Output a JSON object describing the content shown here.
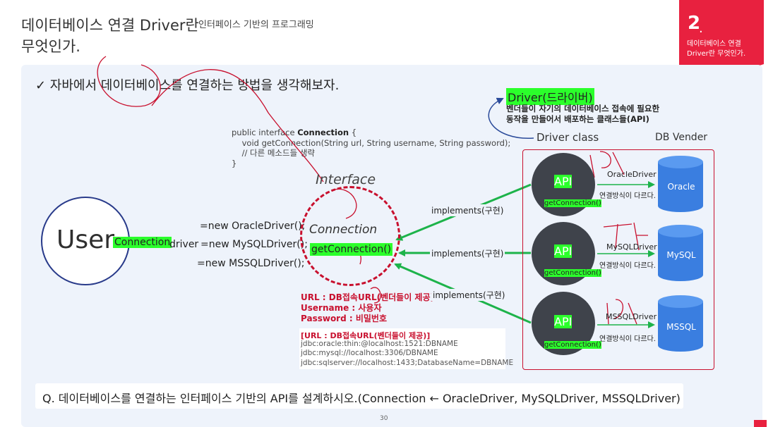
{
  "header": {
    "title_line1": "데이터베이스 연결 Driver란",
    "subtitle": "인터페이스 기반의 프로그래밍",
    "title_line2": "무엇인가."
  },
  "badge": {
    "number": "2",
    "dot": ".",
    "line1": "데이터베이스 연결",
    "line2": "Driver란 무엇인가."
  },
  "heading": "✓ 자바에서 데이터베이스를 연결하는 방법을 생각해보자.",
  "code": {
    "line1_prefix": "public interface ",
    "line1_name": "Connection",
    "line1_suffix": " {",
    "line2": "    void getConnection(String url, String username, String password);",
    "line3": "    // 다른 메소드들 생략",
    "line4": "}"
  },
  "user": {
    "label": "User",
    "connection_tag": "Connection",
    "driver_text": " driver",
    "new_oracle": "=new OracleDriver();",
    "new_mysql": "=new MySQLDriver();",
    "new_mssql": "=new MSSQLDriver();"
  },
  "interface": {
    "label": "Interface",
    "name": "Connection",
    "method": "getConnection()"
  },
  "params": {
    "url": "URL : DB접속URL(벤더들이 제공)",
    "username": "Username : 사용자",
    "password": "Password : 비밀번호"
  },
  "jdbc": {
    "title": "[URL : DB접속URL(벤더들이 제공)]",
    "oracle": "jdbc:oracle:thin:@localhost:1521:DBNAME",
    "mysql": "jdbc:mysql://localhost:3306/DBNAME",
    "mssql": "jdbc:sqlserver://localhost:1433;DatabaseName=DBNAME"
  },
  "implements_label": "implements(구현)",
  "driver_info": {
    "title": "Driver(드라이버)",
    "desc1": "벤더들이 자기의 데이터베이스 접속에 필요한",
    "desc2": "동작을 만들어서 배포하는 클래스들(API)",
    "driver_class": "Driver class",
    "db_vender": "DB Vender"
  },
  "vendors": [
    {
      "api": "API",
      "method": "getConnection()",
      "driver": "OracleDriver",
      "note": "연결방식이 다르다.",
      "db": "Oracle"
    },
    {
      "api": "API",
      "method": "getConnection()",
      "driver": "MySQLDriver",
      "note": "연결방식이 다르다.",
      "db": "MySQL"
    },
    {
      "api": "API",
      "method": "getConnection()",
      "driver": "MSSQLDriver",
      "note": "연결방식이 다르다.",
      "db": "MSSQL"
    }
  ],
  "question": "Q. 데이터베이스를 연결하는 인터페이스 기반의 API를 설계하시오.(Connection ← OracleDriver, MySQLDriver, MSSQLDriver)",
  "page_number": "30",
  "colors": {
    "accent_red": "#e8213f",
    "highlight_green": "#2bff2b",
    "arrow_green": "#1db34a",
    "annotation_red": "#c8102e",
    "db_blue": "#3a7ee0",
    "api_dark": "#3f434b"
  }
}
